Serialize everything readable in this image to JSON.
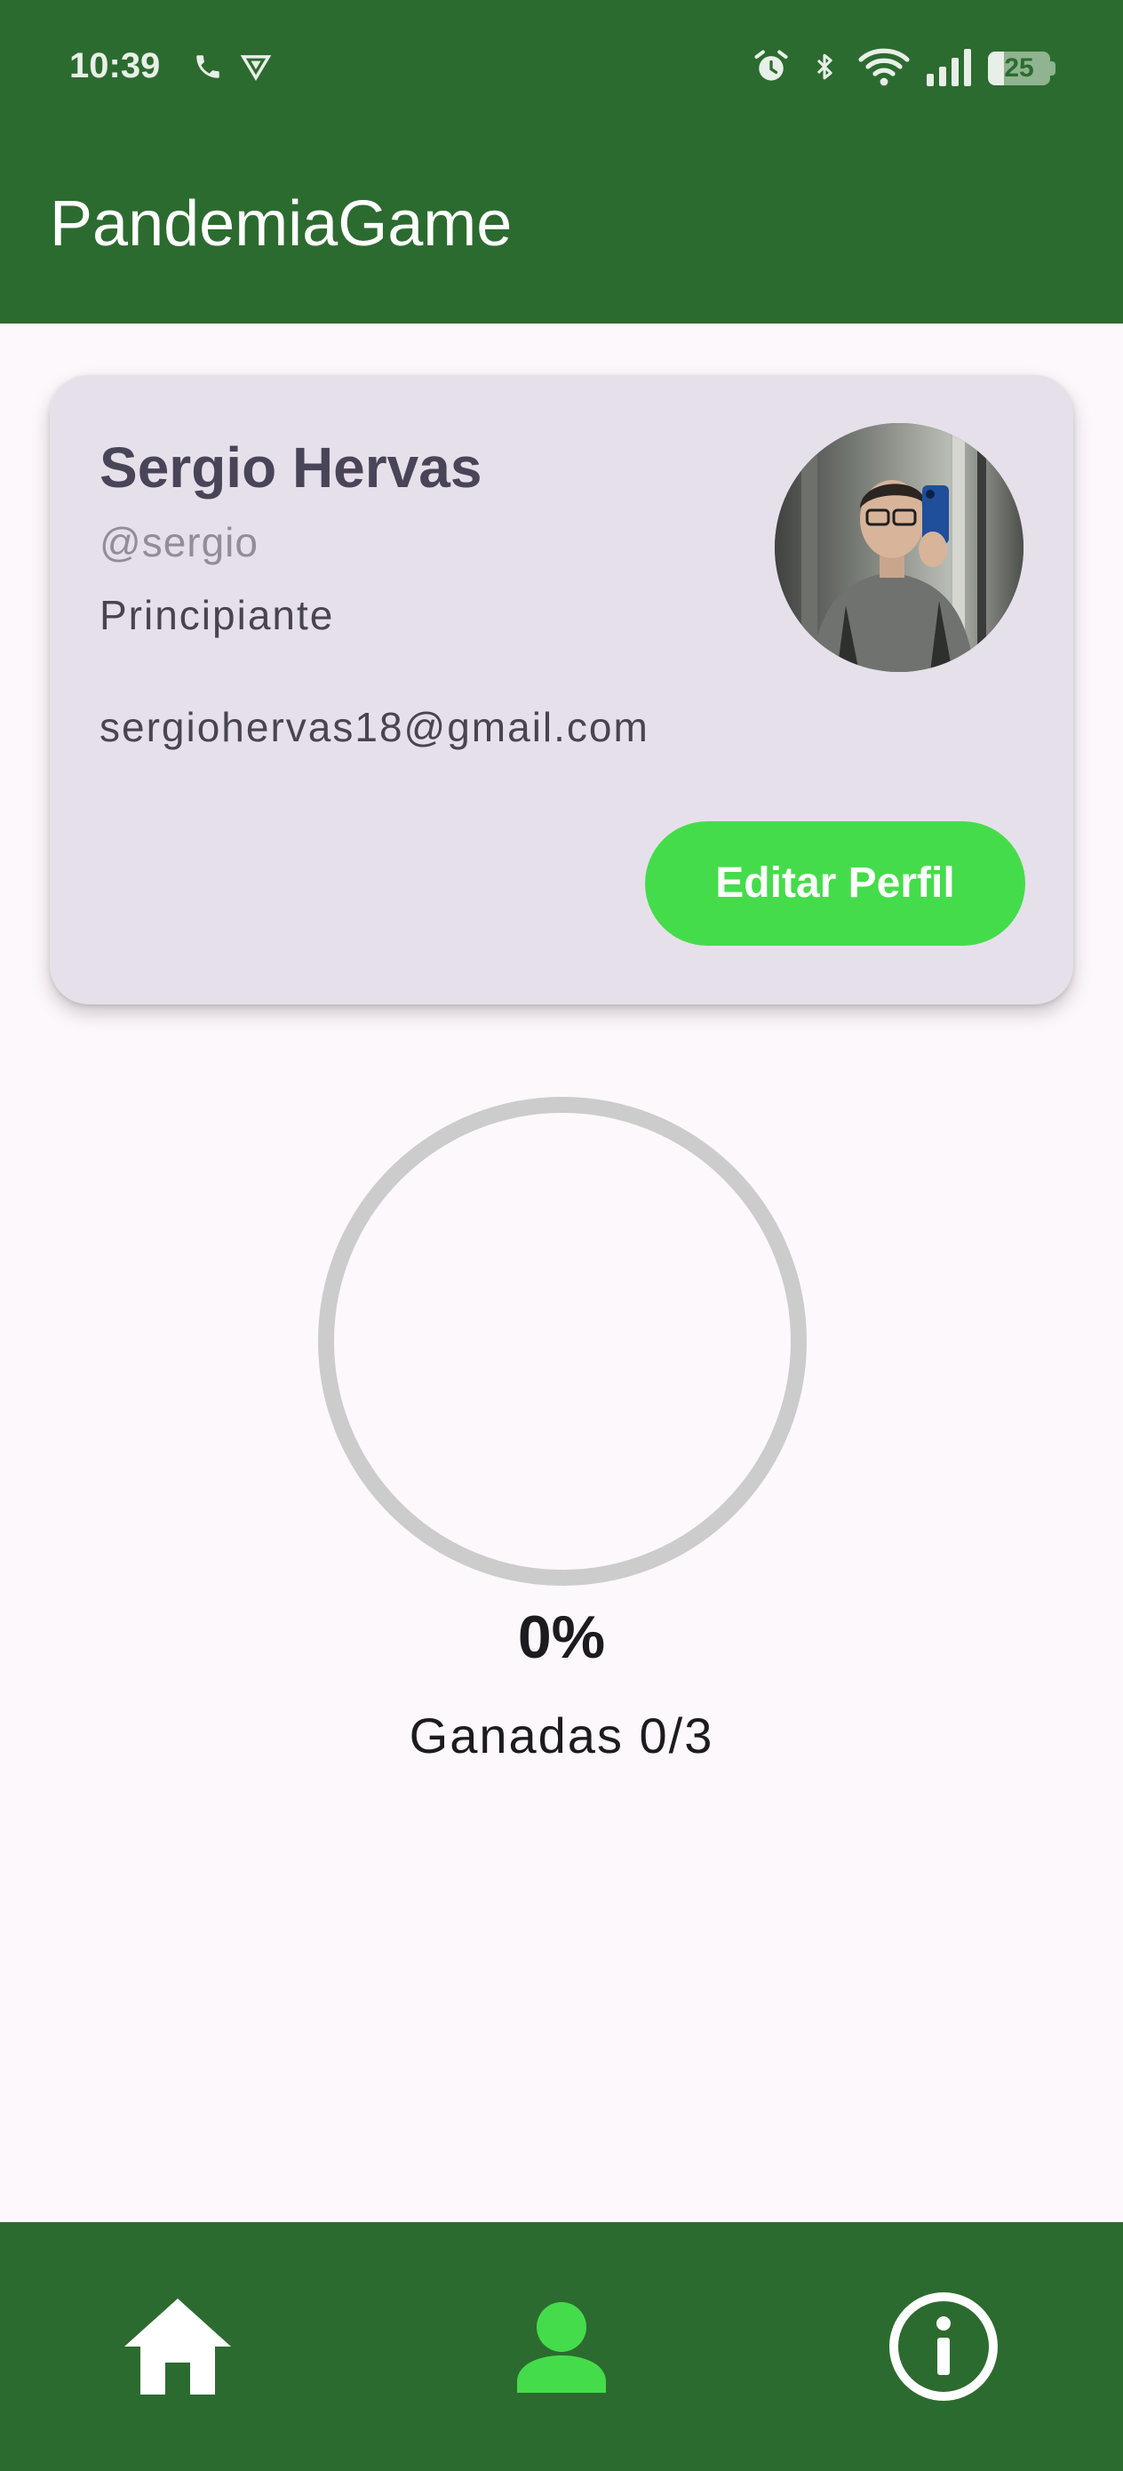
{
  "status_bar": {
    "time": "10:39",
    "battery_level": "25",
    "battery_fraction": 0.25,
    "icons": [
      "phone-icon",
      "vpn-shield-icon",
      "alarm-icon",
      "bluetooth-icon",
      "wifi-icon",
      "signal-icon",
      "battery-icon"
    ]
  },
  "app_bar": {
    "title": "PandemiaGame"
  },
  "profile": {
    "name": "Sergio Hervas",
    "username": "@sergio",
    "level": "Principiante",
    "email": "sergiohervas18@gmail.com",
    "edit_button_label": "Editar Perfil",
    "avatar_description": "profile-photo"
  },
  "stats": {
    "percent_label": "0%",
    "progress_fraction": 0,
    "wins_label": "Ganadas 0/3"
  },
  "bottom_nav": {
    "items": [
      {
        "icon": "home-icon",
        "selected": false
      },
      {
        "icon": "person-icon",
        "selected": true
      },
      {
        "icon": "info-icon",
        "selected": false
      }
    ]
  },
  "colors": {
    "primary_green": "#2c6b2f",
    "accent_green": "#45dc4b",
    "card_background": "#e6e0ea",
    "page_background": "#fdf8fb",
    "ring_track": "#cccccc"
  }
}
